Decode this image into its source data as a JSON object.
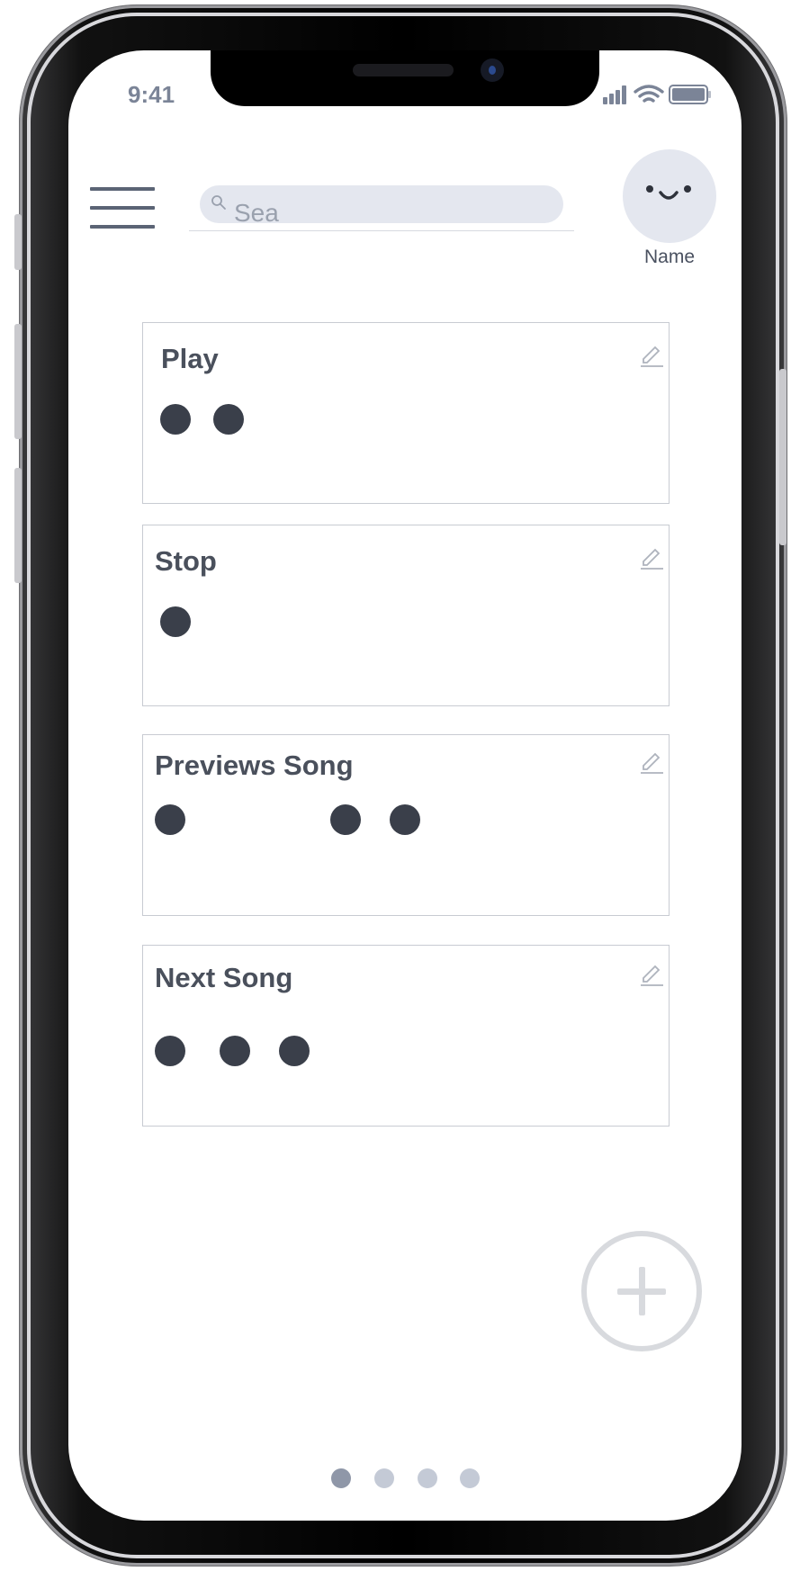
{
  "status_bar": {
    "time": "9:41"
  },
  "header": {
    "search_placeholder": "Sea",
    "avatar_label": "Name"
  },
  "cards": [
    {
      "title": "Play",
      "dots": 2
    },
    {
      "title": "Stop",
      "dots": 1
    },
    {
      "title": "Previews Song",
      "dots": 3
    },
    {
      "title": "Next Song",
      "dots": 3
    }
  ],
  "pagination": {
    "pages": 4,
    "active": 1
  },
  "colors": {
    "accent_dark": "#3a3f4a",
    "muted": "#c4cad6",
    "search_bg": "#e4e7ef"
  }
}
